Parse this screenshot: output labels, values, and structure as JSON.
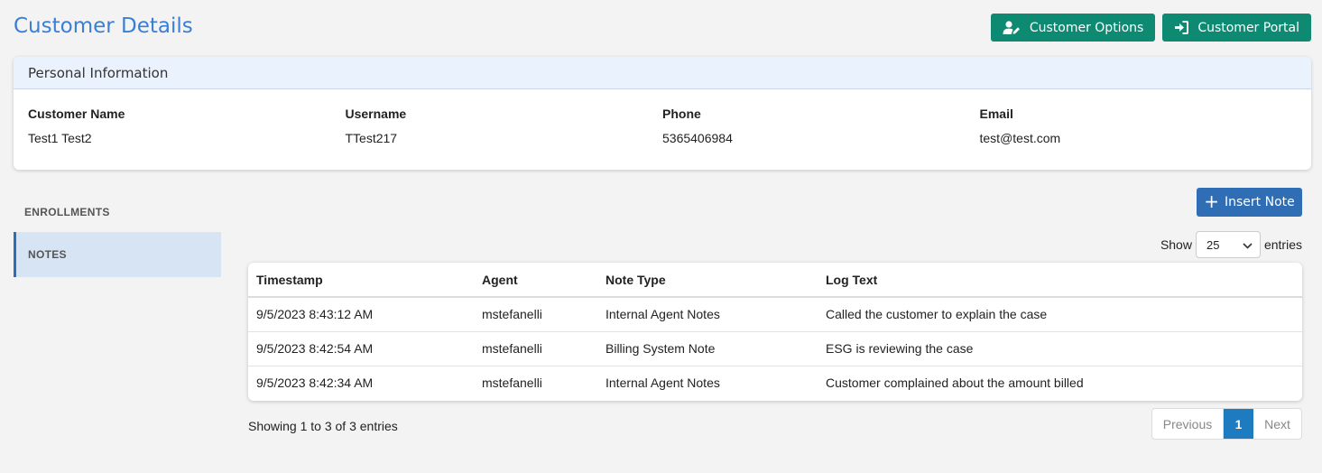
{
  "header": {
    "title": "Customer Details",
    "customer_options_label": "Customer Options",
    "customer_portal_label": "Customer Portal"
  },
  "personal_info": {
    "heading": "Personal Information",
    "fields": [
      {
        "label": "Customer Name",
        "value": "Test1 Test2"
      },
      {
        "label": "Username",
        "value": "TTest217"
      },
      {
        "label": "Phone",
        "value": "5365406984"
      },
      {
        "label": "Email",
        "value": "test@test.com"
      }
    ]
  },
  "sidenav": {
    "items": [
      {
        "label": "ENROLLMENTS"
      },
      {
        "label": "NOTES"
      }
    ],
    "active": "NOTES"
  },
  "notes": {
    "insert_label": "Insert Note",
    "length_prefix": "Show",
    "length_value": "25",
    "length_suffix": "entries",
    "columns": [
      "Timestamp",
      "Agent",
      "Note Type",
      "Log Text"
    ],
    "rows": [
      [
        "9/5/2023 8:43:12 AM",
        "mstefanelli",
        "Internal Agent Notes",
        "Called the customer to explain the case"
      ],
      [
        "9/5/2023 8:42:54 AM",
        "mstefanelli",
        "Billing System Note",
        "ESG is reviewing the case"
      ],
      [
        "9/5/2023 8:42:34 AM",
        "mstefanelli",
        "Internal Agent Notes",
        "Customer complained about the amount billed"
      ]
    ],
    "info": "Showing 1 to 3 of 3 entries",
    "pagination": {
      "previous": "Previous",
      "page": "1",
      "next": "Next"
    }
  },
  "colors": {
    "title": "#3a7fd5",
    "teal_button": "#0e8a72",
    "blue_button": "#2f6db5",
    "active_page": "#1f7bbf"
  }
}
